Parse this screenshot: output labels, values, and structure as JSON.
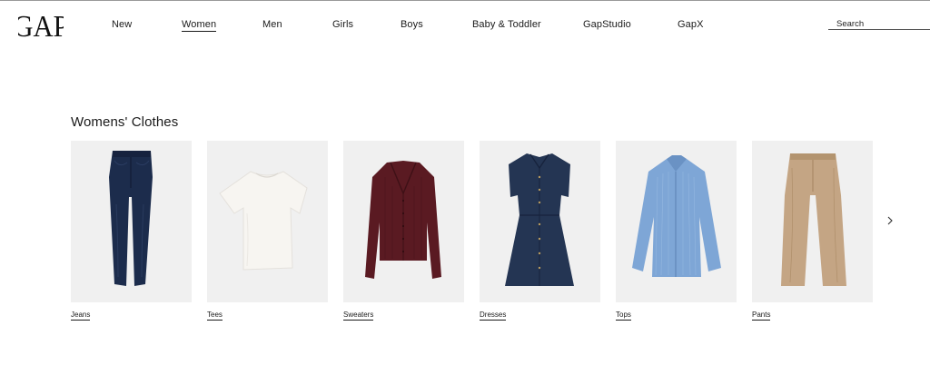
{
  "brand": {
    "logo_text": "GAP"
  },
  "nav": {
    "items": [
      {
        "label": "New"
      },
      {
        "label": "Women",
        "active": true
      },
      {
        "label": "Men"
      },
      {
        "label": "Girls"
      },
      {
        "label": "Boys"
      },
      {
        "label": "Baby & Toddler"
      },
      {
        "label": "GapStudio"
      },
      {
        "label": "GapX"
      }
    ]
  },
  "search": {
    "placeholder": "Search",
    "value": ""
  },
  "section": {
    "title": "Womens' Clothes"
  },
  "categories": [
    {
      "label": "Jeans",
      "icon": "jeans-product-image",
      "color": "#1c2c4c"
    },
    {
      "label": "Tees",
      "icon": "tee-product-image",
      "color": "#f6f4f0"
    },
    {
      "label": "Sweaters",
      "icon": "cardigan-product-image",
      "color": "#5a1a22"
    },
    {
      "label": "Dresses",
      "icon": "denim-dress-product-image",
      "color": "#243553"
    },
    {
      "label": "Tops",
      "icon": "striped-shirt-product-image",
      "color": "#7ea6d6"
    },
    {
      "label": "Pants",
      "icon": "khaki-pants-product-image",
      "color": "#c4a584"
    }
  ],
  "carousel": {
    "next_icon": "chevron-right-icon"
  }
}
